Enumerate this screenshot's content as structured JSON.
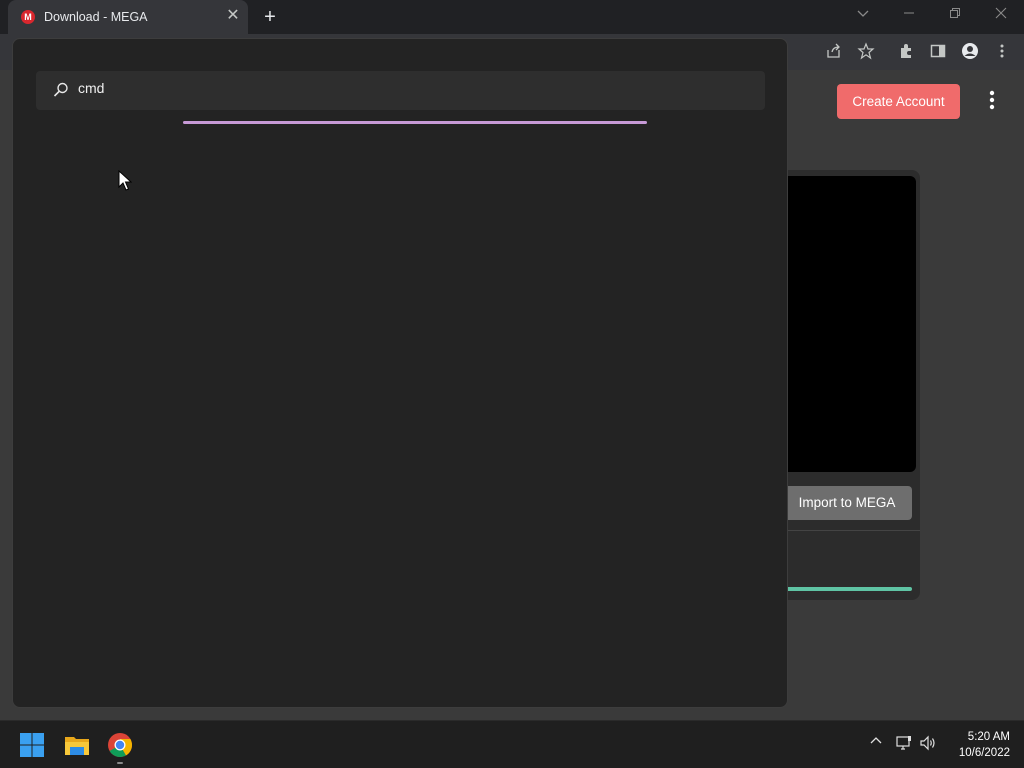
{
  "browser": {
    "tab_title": "Download - MEGA",
    "tab_favicon_letter": "M",
    "new_tab_symbol": "+",
    "close_symbol": "✕"
  },
  "page": {
    "create_account_label": "Create Account",
    "import_label": "Import to MEGA",
    "accent_color": "#f06b6b"
  },
  "search": {
    "query": "cmd",
    "loading_bar_color": "#c79ad6"
  },
  "taskbar": {
    "time": "5:20 AM",
    "date": "10/6/2022",
    "apps": [
      "start-icon",
      "file-explorer-icon",
      "chrome-icon"
    ]
  }
}
